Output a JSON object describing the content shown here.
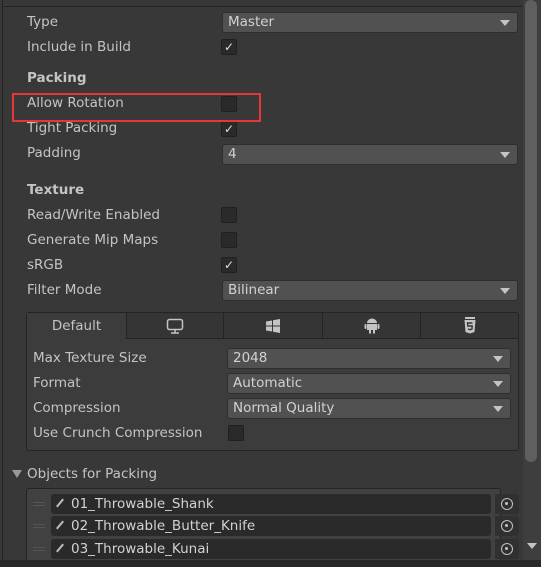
{
  "fields": {
    "type": {
      "label": "Type",
      "value": "Master"
    },
    "include_in_build": {
      "label": "Include in Build",
      "checked": true
    }
  },
  "packing": {
    "header": "Packing",
    "allow_rotation": {
      "label": "Allow Rotation",
      "checked": false
    },
    "tight_packing": {
      "label": "Tight Packing",
      "checked": true
    },
    "padding": {
      "label": "Padding",
      "value": "4"
    }
  },
  "texture": {
    "header": "Texture",
    "read_write": {
      "label": "Read/Write Enabled",
      "checked": false
    },
    "mip_maps": {
      "label": "Generate Mip Maps",
      "checked": false
    },
    "srgb": {
      "label": "sRGB",
      "checked": true
    },
    "filter_mode": {
      "label": "Filter Mode",
      "value": "Bilinear"
    }
  },
  "platform_tabs": [
    {
      "label": "Default",
      "icon": "default",
      "active": true
    },
    {
      "label": "",
      "icon": "monitor-icon"
    },
    {
      "label": "",
      "icon": "windows-icon"
    },
    {
      "label": "",
      "icon": "android-icon"
    },
    {
      "label": "",
      "icon": "html5-icon"
    }
  ],
  "platform": {
    "max_texture_size": {
      "label": "Max Texture Size",
      "value": "2048"
    },
    "format": {
      "label": "Format",
      "value": "Automatic"
    },
    "compression": {
      "label": "Compression",
      "value": "Normal Quality"
    },
    "crunch": {
      "label": "Use Crunch Compression",
      "checked": false
    }
  },
  "objects": {
    "header": "Objects for Packing",
    "items": [
      "01_Throwable_Shank",
      "02_Throwable_Butter_Knife",
      "03_Throwable_Kunai"
    ]
  },
  "colors": {
    "highlight": "#e8353a",
    "background": "#383838"
  },
  "check_glyph": "✓"
}
